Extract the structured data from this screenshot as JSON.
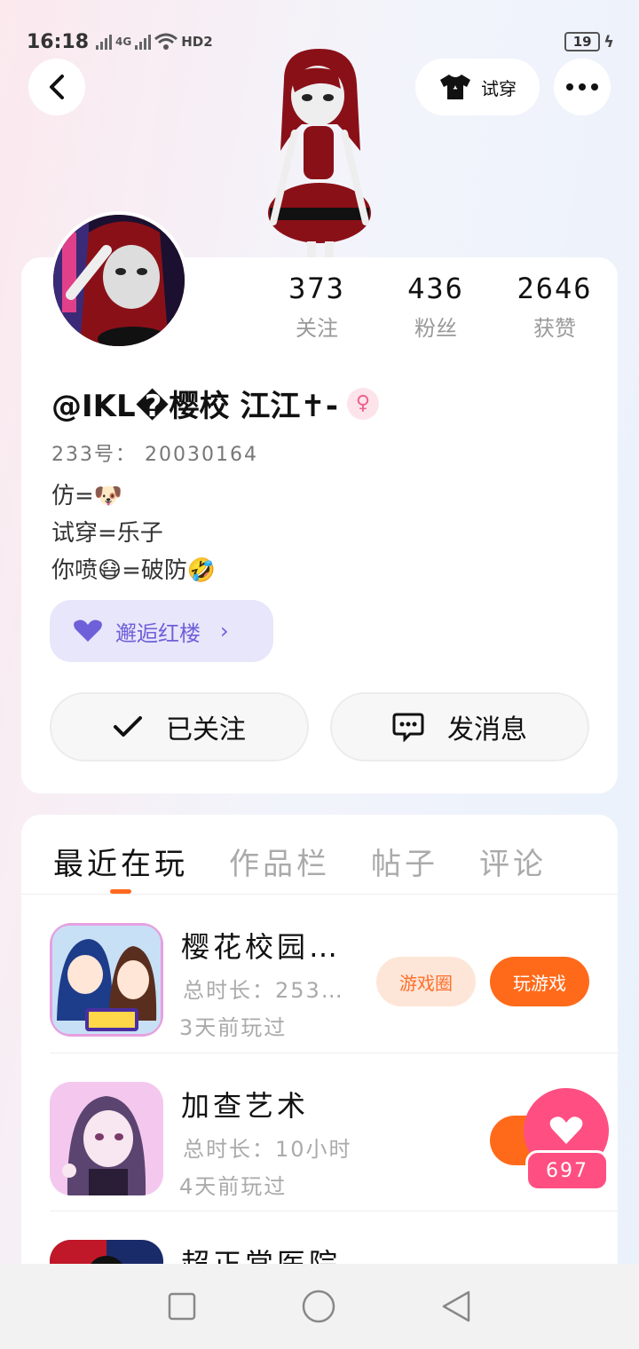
{
  "status_bar": {
    "time": "16:18",
    "network_label": "4G",
    "wifi_label": "HD2",
    "battery": "19"
  },
  "header": {
    "tryon_label": "试穿"
  },
  "profile": {
    "stats": [
      {
        "value": "373",
        "label": "关注"
      },
      {
        "value": "436",
        "label": "粉丝"
      },
      {
        "value": "2646",
        "label": "获赞"
      }
    ],
    "username": "@IKL�樱校 江江✝-",
    "gender_symbol": "♀",
    "id_line": "233号： 20030164",
    "bio": [
      "仿=🐶",
      "试穿=乐子",
      "你喷😷=破防🤣"
    ],
    "tag": {
      "label": "邂逅红楼"
    },
    "followed_label": "已关注",
    "message_label": "发消息"
  },
  "tabs": [
    {
      "label": "最近在玩",
      "active": true
    },
    {
      "label": "作品栏",
      "active": false
    },
    {
      "label": "帖子",
      "active": false
    },
    {
      "label": "评论",
      "active": false
    }
  ],
  "games": [
    {
      "title": "樱花校园…",
      "duration": "总时长：253…",
      "last_played": "3天前玩过",
      "circle_label": "游戏圈",
      "play_label": "玩游戏"
    },
    {
      "title": "加查艺术",
      "duration": "总时长：10小时",
      "last_played": "4天前玩过",
      "play_label": "玩"
    },
    {
      "title": "超正常医院"
    }
  ],
  "like": {
    "count": "697"
  },
  "colors": {
    "accent": "#ff6a1a",
    "like_pink": "#ff4f82",
    "tag_purple": "#6e60d8"
  }
}
